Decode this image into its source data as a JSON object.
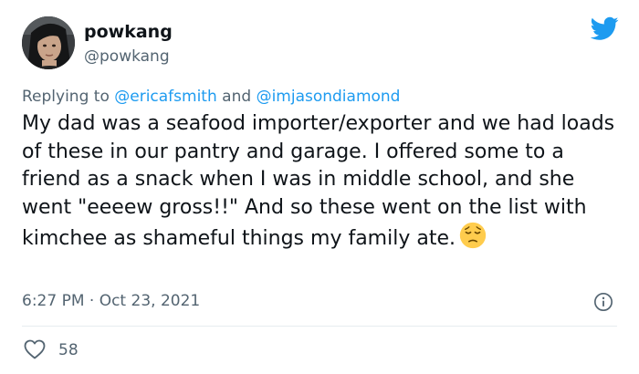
{
  "author": {
    "display_name": "powkang",
    "handle": "@powkang",
    "avatar_icon": "profile-photo"
  },
  "reply": {
    "prefix": "Replying to",
    "mention1": "@ericafsmith",
    "connector": "and",
    "mention2": "@imjasondiamond"
  },
  "tweet": {
    "text": "My dad was a seafood importer/exporter and we had loads of these in our pantry and garage. I offered some to a friend as a snack when I was in middle school, and she went \"eeeew gross!!\" And so these went on the list with kimchee as shameful things my family ate.",
    "emoji": "pensive-face-emoji",
    "timestamp": "6:27 PM · Oct 23, 2021"
  },
  "engagement": {
    "likes": "58"
  },
  "icons": {
    "brand": "twitter-bird-icon",
    "info": "info-icon",
    "like": "heart-icon"
  },
  "colors": {
    "brand_blue": "#1d9bf0",
    "text_primary": "#0f1419",
    "text_secondary": "#536471",
    "divider": "#e6ecf0"
  }
}
